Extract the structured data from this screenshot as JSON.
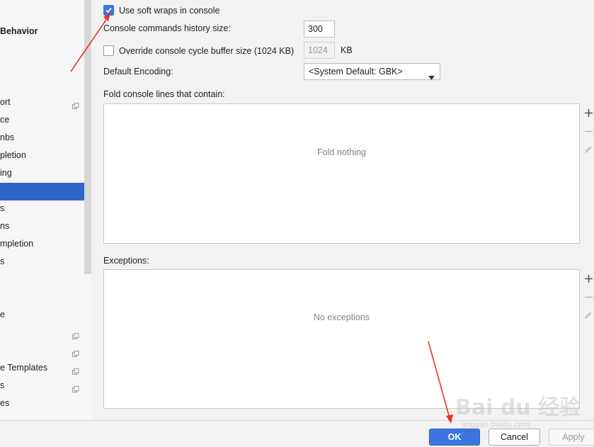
{
  "sidebar": {
    "items": [
      {
        "label": "Behavior",
        "kind": "header"
      },
      {
        "label": "ort",
        "copy": true
      },
      {
        "label": "ce"
      },
      {
        "label": "nbs"
      },
      {
        "label": "pletion"
      },
      {
        "label": "ing"
      },
      {
        "label": "",
        "selected": true
      },
      {
        "label": "s"
      },
      {
        "label": "ns"
      },
      {
        "label": "mpletion"
      },
      {
        "label": "s"
      },
      {
        "label": "e"
      },
      {
        "label": "",
        "copy": true
      },
      {
        "label": "",
        "copy": true
      },
      {
        "label": "e Templates",
        "copy": true
      },
      {
        "label": "s",
        "copy": true
      },
      {
        "label": "es"
      }
    ]
  },
  "console": {
    "soft_wraps_label": "Use soft wraps in console",
    "soft_wraps_checked": true,
    "history_label": "Console commands history size:",
    "history_value": "300",
    "override_label": "Override console cycle buffer size (1024 KB)",
    "override_checked": false,
    "buffer_value": "1024",
    "buffer_unit": "KB",
    "encoding_label": "Default Encoding:",
    "encoding_value": "<System Default: GBK>",
    "fold_label": "Fold console lines that contain:",
    "fold_empty": "Fold nothing",
    "exceptions_label": "Exceptions:",
    "exceptions_empty": "No exceptions"
  },
  "buttons": {
    "ok": "OK",
    "cancel": "Cancel",
    "apply": "Apply"
  },
  "watermark": {
    "main": "Bai du 经验",
    "sub": "jingyan.baidu.com"
  },
  "colors": {
    "selection": "#2f65ca",
    "accent": "#3c75e0",
    "annotation_arrow": "#e8322d"
  }
}
